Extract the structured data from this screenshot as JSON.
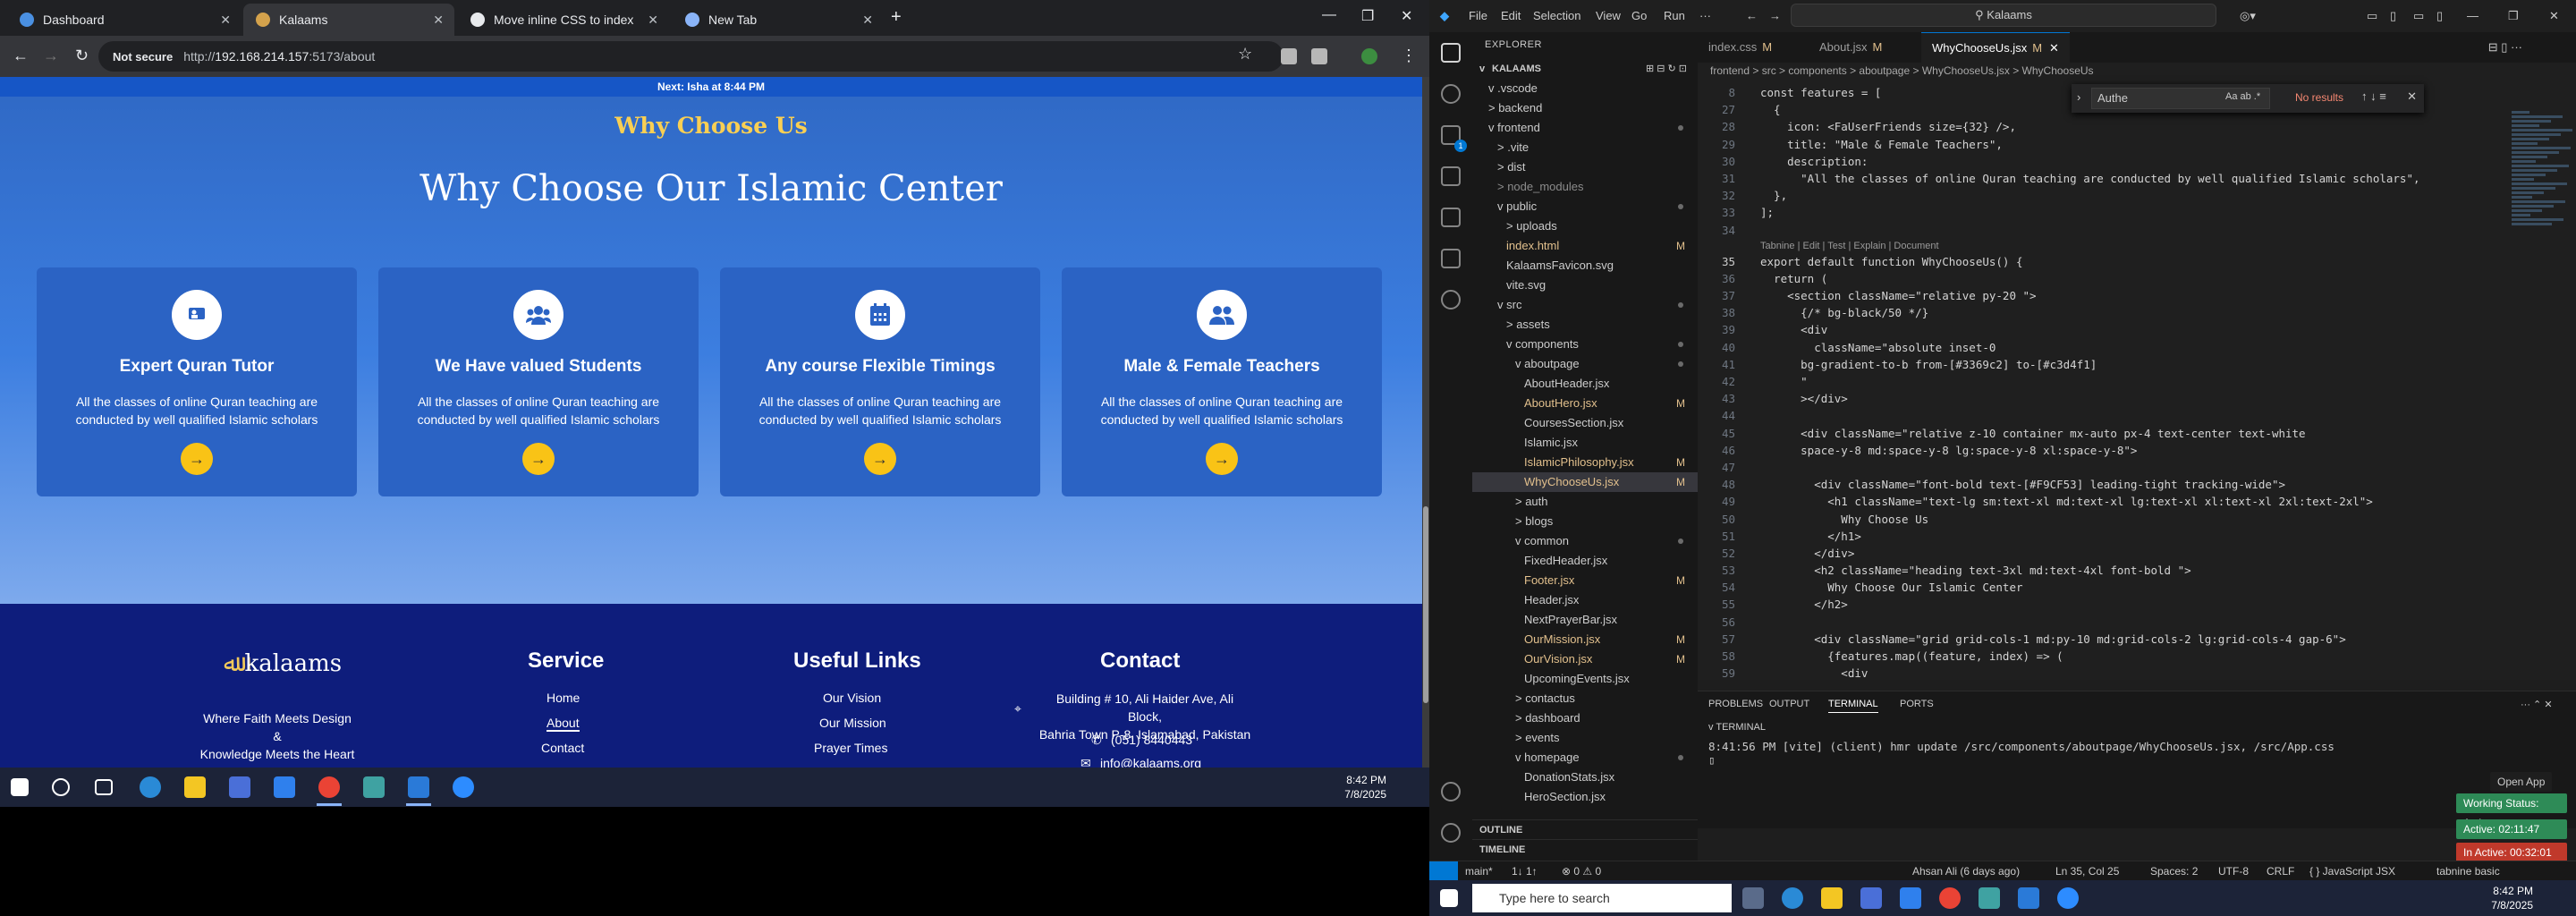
{
  "browser": {
    "tabs": [
      {
        "label": "Dashboard",
        "color": "#4a90e2"
      },
      {
        "label": "Kalaams",
        "color": "#d4a24c"
      },
      {
        "label": "Move inline CSS to index",
        "color": "#e8eaed"
      },
      {
        "label": "New Tab",
        "color": "#8ab4f8"
      }
    ],
    "not_secure": "Not secure",
    "url_prefix": "http://",
    "url_host": "192.168.214.157",
    "url_rest": ":5173/about"
  },
  "page": {
    "next_prayer": "Next: Isha at 8:44 PM",
    "eyebrow": "Why Choose Us",
    "heading": "Why Choose Our Islamic Center",
    "cards": [
      {
        "title": "Expert Quran Tutor",
        "desc": "All the classes of online Quran teaching are conducted by well qualified Islamic scholars",
        "icon": "chalkboard-teacher-icon"
      },
      {
        "title": "We Have valued Students",
        "desc": "All the classes of online Quran teaching are conducted by well qualified Islamic scholars",
        "icon": "users-icon"
      },
      {
        "title": "Any course Flexible Timings",
        "desc": "All the classes of online Quran teaching are conducted by well qualified Islamic scholars",
        "icon": "calendar-icon"
      },
      {
        "title": "Male & Female Teachers",
        "desc": "All the classes of online Quran teaching are conducted by well qualified Islamic scholars",
        "icon": "user-friends-icon"
      }
    ],
    "arrow": "→",
    "footer": {
      "logo": "kalaams",
      "tagline": [
        "Where Faith Meets Design",
        "&",
        "Knowledge Meets the Heart"
      ],
      "service_heading": "Service",
      "service_links": [
        "Home",
        "About",
        "Contact"
      ],
      "useful_heading": "Useful Links",
      "useful_links": [
        "Our Vision",
        "Our Mission",
        "Prayer Times"
      ],
      "contact_heading": "Contact",
      "address": [
        "Building # 10, Ali Haider Ave, Ali Block,",
        "Bahria Town P-8, Islamabad, Pakistan"
      ],
      "phone": "(051) 8440443",
      "email": "info@kalaams.org"
    }
  },
  "left_taskbar": {
    "time": "8:42 PM",
    "date": "7/8/2025"
  },
  "vscode": {
    "menu": [
      "File",
      "Edit",
      "Selection",
      "View",
      "Go",
      "Run",
      "···"
    ],
    "search": "Kalaams",
    "explorer_title": "EXPLORER",
    "root": "KALAAMS",
    "tree": [
      {
        "d": 1,
        "name": "v  .vscode"
      },
      {
        "d": 1,
        "name": ">  backend"
      },
      {
        "d": 1,
        "name": "v  frontend",
        "dot": true
      },
      {
        "d": 2,
        "name": ">  .vite"
      },
      {
        "d": 2,
        "name": ">  dist"
      },
      {
        "d": 2,
        "name": ">  node_modules",
        "dim": true
      },
      {
        "d": 2,
        "name": "v  public",
        "dot": true
      },
      {
        "d": 3,
        "name": ">  uploads"
      },
      {
        "d": 3,
        "name": "index.html",
        "st": "M"
      },
      {
        "d": 3,
        "name": "KalaamsFavicon.svg"
      },
      {
        "d": 3,
        "name": "vite.svg"
      },
      {
        "d": 2,
        "name": "v  src",
        "dot": true
      },
      {
        "d": 3,
        "name": ">  assets"
      },
      {
        "d": 3,
        "name": "v  components",
        "dot": true
      },
      {
        "d": 4,
        "name": "v  aboutpage",
        "dot": true
      },
      {
        "d": 5,
        "name": "AboutHeader.jsx"
      },
      {
        "d": 5,
        "name": "AboutHero.jsx",
        "st": "M"
      },
      {
        "d": 5,
        "name": "CoursesSection.jsx"
      },
      {
        "d": 5,
        "name": "Islamic.jsx"
      },
      {
        "d": 5,
        "name": "IslamicPhilosophy.jsx",
        "st": "M"
      },
      {
        "d": 5,
        "name": "WhyChooseUs.jsx",
        "st": "M",
        "sel": true
      },
      {
        "d": 4,
        "name": ">  auth"
      },
      {
        "d": 4,
        "name": ">  blogs"
      },
      {
        "d": 4,
        "name": "v  common",
        "dot": true
      },
      {
        "d": 5,
        "name": "FixedHeader.jsx"
      },
      {
        "d": 5,
        "name": "Footer.jsx",
        "st": "M"
      },
      {
        "d": 5,
        "name": "Header.jsx"
      },
      {
        "d": 5,
        "name": "NextPrayerBar.jsx"
      },
      {
        "d": 5,
        "name": "OurMission.jsx",
        "st": "M"
      },
      {
        "d": 5,
        "name": "OurVision.jsx",
        "st": "M"
      },
      {
        "d": 5,
        "name": "UpcomingEvents.jsx"
      },
      {
        "d": 4,
        "name": ">  contactus"
      },
      {
        "d": 4,
        "name": ">  dashboard"
      },
      {
        "d": 4,
        "name": ">  events"
      },
      {
        "d": 4,
        "name": "v  homepage",
        "dot": true
      },
      {
        "d": 5,
        "name": "DonationStats.jsx"
      },
      {
        "d": 5,
        "name": "HeroSection.jsx"
      }
    ],
    "outline": "OUTLINE",
    "timeline": "TIMELINE",
    "tabs": [
      {
        "label": "index.css",
        "mark": "M"
      },
      {
        "label": "About.jsx",
        "mark": "M"
      },
      {
        "label": "WhyChooseUs.jsx",
        "mark": "M"
      }
    ],
    "breadcrumb": "frontend > src > components > aboutpage > WhyChooseUs.jsx > WhyChooseUs",
    "find_value": "Authe",
    "find_result": "No results",
    "code": [
      {
        "n": "27",
        "t": "  {"
      },
      {
        "n": "28",
        "t": "    icon: <FaUserFriends size={32} />,"
      },
      {
        "n": "29",
        "t": "    title: \"Male & Female Teachers\","
      },
      {
        "n": "30",
        "t": "    description:"
      },
      {
        "n": "31",
        "t": "      \"All the classes of online Quran teaching are conducted by well qualified Islamic scholars\","
      },
      {
        "n": "32",
        "t": "  },"
      },
      {
        "n": "33",
        "t": "];"
      },
      {
        "n": "34",
        "t": ""
      },
      {
        "n": "35",
        "t": "export default function WhyChooseUs() {",
        "lens": true
      },
      {
        "n": "36",
        "t": "  return ("
      },
      {
        "n": "37",
        "t": "    <section className=\"relative py-20 \">"
      },
      {
        "n": "38",
        "t": "      {/* bg-black/50 */}"
      },
      {
        "n": "39",
        "t": "      <div"
      },
      {
        "n": "40",
        "t": "        className=\"absolute inset-0"
      },
      {
        "n": "41",
        "t": "      bg-gradient-to-b from-[#3369c2] to-[#c3d4f1]"
      },
      {
        "n": "42",
        "t": "      \""
      },
      {
        "n": "43",
        "t": "      ></div>"
      },
      {
        "n": "44",
        "t": ""
      },
      {
        "n": "45",
        "t": "      <div className=\"relative z-10 container mx-auto px-4 text-center text-white"
      },
      {
        "n": "46",
        "t": "      space-y-8 md:space-y-8 lg:space-y-8 xl:space-y-8\">"
      },
      {
        "n": "47",
        "t": ""
      },
      {
        "n": "48",
        "t": "        <div className=\"font-bold text-[#F9CF53] leading-tight tracking-wide\">"
      },
      {
        "n": "49",
        "t": "          <h1 className=\"text-lg sm:text-xl md:text-xl lg:text-xl xl:text-xl 2xl:text-2xl\">"
      },
      {
        "n": "50",
        "t": "            Why Choose Us"
      },
      {
        "n": "51",
        "t": "          </h1>"
      },
      {
        "n": "52",
        "t": "        </div>"
      },
      {
        "n": "53",
        "t": "        <h2 className=\"heading text-3xl md:text-4xl font-bold \">"
      },
      {
        "n": "54",
        "t": "          Why Choose Our Islamic Center"
      },
      {
        "n": "55",
        "t": "        </h2>"
      },
      {
        "n": "56",
        "t": ""
      },
      {
        "n": "57",
        "t": "        <div className=\"grid grid-cols-1 md:py-10 md:grid-cols-2 lg:grid-cols-4 gap-6\">"
      },
      {
        "n": "58",
        "t": "          {features.map((feature, index) => ("
      },
      {
        "n": "59",
        "t": "            <div"
      }
    ],
    "code_top_line": {
      "n": "8",
      "t": "const features = ["
    },
    "codelens": "Tabnine | Edit | Test | Explain | Document",
    "panel_tabs": [
      "PROBLEMS",
      "OUTPUT",
      "TERMINAL",
      "PORTS"
    ],
    "terminal_title": "TERMINAL",
    "terminal_line": "8:41:56 PM [vite] (client) hmr update /src/components/aboutpage/WhyChooseUs.jsx, /src/App.css",
    "open_app": "Open App",
    "working_status": "Working Status: Active",
    "active_time": "Active: 02:11:47",
    "inactive_time": "In Active: 00:32:01",
    "status_bar": {
      "branch": "main*",
      "sync": "1↓ 1↑",
      "problems": "⊗ 0 ⚠ 0",
      "blame": "Ahsan Ali (6 days ago)",
      "position": "Ln 35, Col 25",
      "spaces": "Spaces: 2",
      "encoding": "UTF-8",
      "eol": "CRLF",
      "language": "{ } JavaScript JSX",
      "tabnine": "tabnine basic"
    }
  },
  "right_taskbar": {
    "search": "Type here to search",
    "time": "8:42 PM",
    "date": "7/8/2025"
  }
}
